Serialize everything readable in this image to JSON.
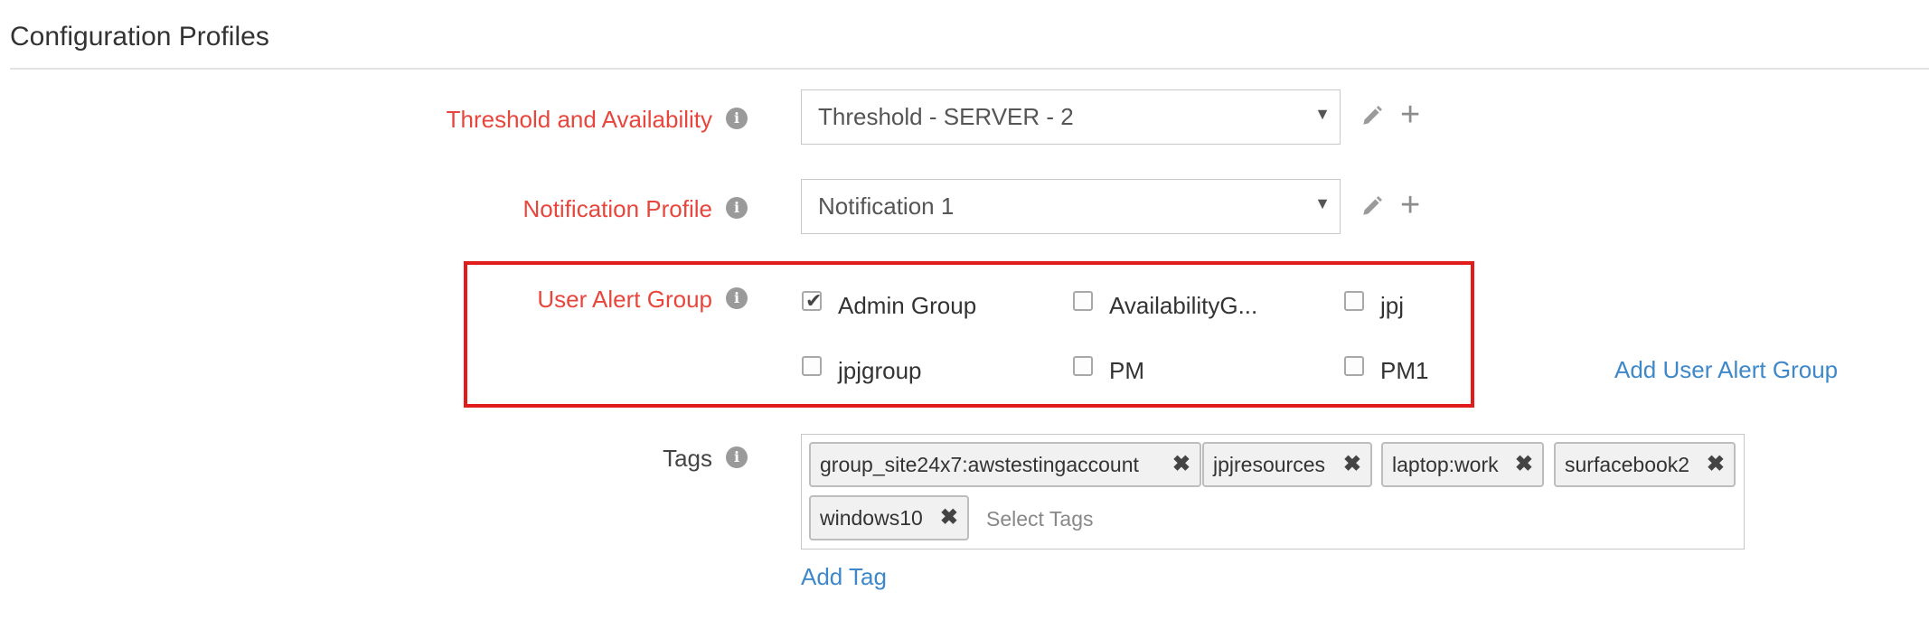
{
  "section": {
    "title": "Configuration Profiles"
  },
  "threshold": {
    "label": "Threshold and Availability",
    "value": "Threshold - SERVER - 2"
  },
  "notification": {
    "label": "Notification Profile",
    "value": "Notification 1"
  },
  "user_alert": {
    "label": "User Alert Group",
    "groups": [
      {
        "label": "Admin Group",
        "checked": true
      },
      {
        "label": "AvailabilityG...",
        "checked": false
      },
      {
        "label": "jpj",
        "checked": false
      },
      {
        "label": "jpjgroup",
        "checked": false
      },
      {
        "label": "PM",
        "checked": false
      },
      {
        "label": "PM1",
        "checked": false
      }
    ],
    "add_link": "Add User Alert Group"
  },
  "tags": {
    "label": "Tags",
    "chips": [
      "group_site24x7:awstestingaccount",
      "jpjresources",
      "laptop:work",
      "surfacebook2",
      "windows10"
    ],
    "placeholder": "Select Tags",
    "add_link": "Add Tag"
  },
  "icons": {
    "info": "info-icon",
    "edit": "pencil-icon",
    "add": "plus-icon",
    "remove": "close-icon",
    "dropdown": "caret-down-icon"
  },
  "colors": {
    "required_label": "#e8463c",
    "link": "#3e88c9",
    "highlight_border": "#e11c1c"
  }
}
